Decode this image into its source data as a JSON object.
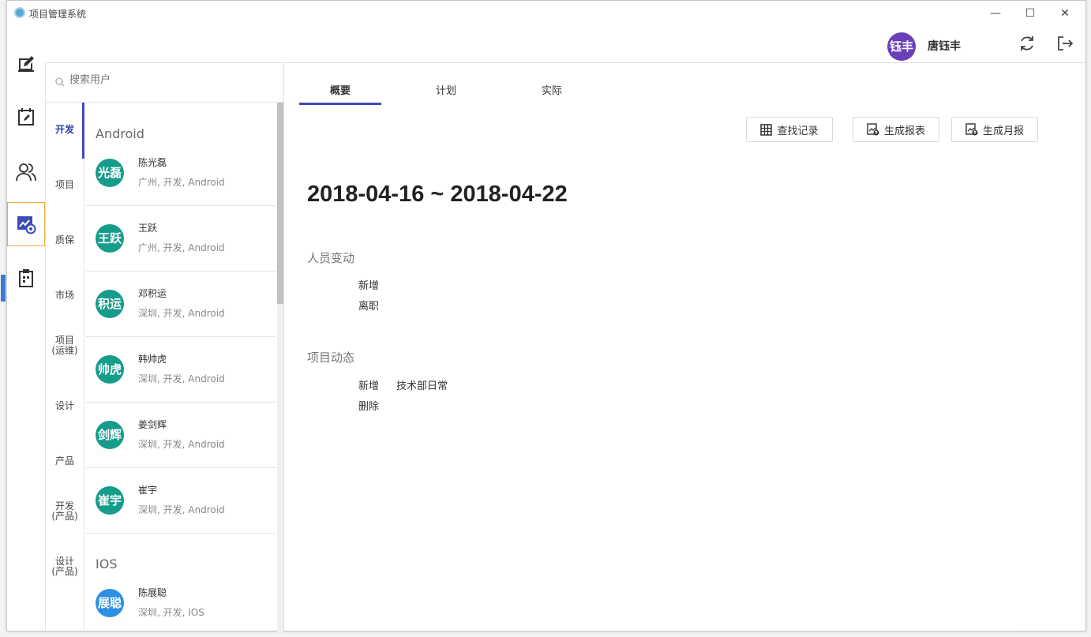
{
  "window": {
    "title": "项目管理系统",
    "minimize": "—",
    "maximize": "☐",
    "close": "✕"
  },
  "header": {
    "user_avatar_text": "钰丰",
    "user_name": "唐钰丰"
  },
  "search": {
    "placeholder": "搜索用户"
  },
  "departments": [
    "开发",
    "项目",
    "质保",
    "市场",
    "项目\n(运维)",
    "设计",
    "产品",
    "开发\n(产品)",
    "设计\n(产品)"
  ],
  "groups": [
    {
      "title": "Android",
      "users": [
        {
          "avatar": "光磊",
          "name": "陈光磊",
          "meta": "广州, 开发, Android",
          "color": "#169c8a"
        },
        {
          "avatar": "王跃",
          "name": "王跃",
          "meta": "广州, 开发, Android",
          "color": "#169c8a"
        },
        {
          "avatar": "积运",
          "name": "邓积运",
          "meta": "深圳, 开发, Android",
          "color": "#169c8a"
        },
        {
          "avatar": "帅虎",
          "name": "韩帅虎",
          "meta": "深圳, 开发, Android",
          "color": "#169c8a"
        },
        {
          "avatar": "剑辉",
          "name": "姜剑辉",
          "meta": "深圳, 开发, Android",
          "color": "#169c8a"
        },
        {
          "avatar": "崔宇",
          "name": "崔宇",
          "meta": "深圳, 开发, Android",
          "color": "#169c8a"
        }
      ]
    },
    {
      "title": "IOS",
      "users": [
        {
          "avatar": "展聪",
          "name": "陈展聪",
          "meta": "深圳, 开发, IOS",
          "color": "#2d8fe6"
        }
      ]
    }
  ],
  "tabs": [
    "概要",
    "计划",
    "实际"
  ],
  "actions": {
    "find_records": "查找记录",
    "generate_report": "生成报表",
    "generate_monthly": "生成月报"
  },
  "summary": {
    "date_range": "2018-04-16 ~ 2018-04-22",
    "personnel_title": "人员变动",
    "personnel_rows": [
      {
        "label": "新增",
        "value": ""
      },
      {
        "label": "离职",
        "value": ""
      }
    ],
    "project_title": "项目动态",
    "project_rows": [
      {
        "label": "新增",
        "value": "技术部日常"
      },
      {
        "label": "删除",
        "value": ""
      }
    ]
  }
}
